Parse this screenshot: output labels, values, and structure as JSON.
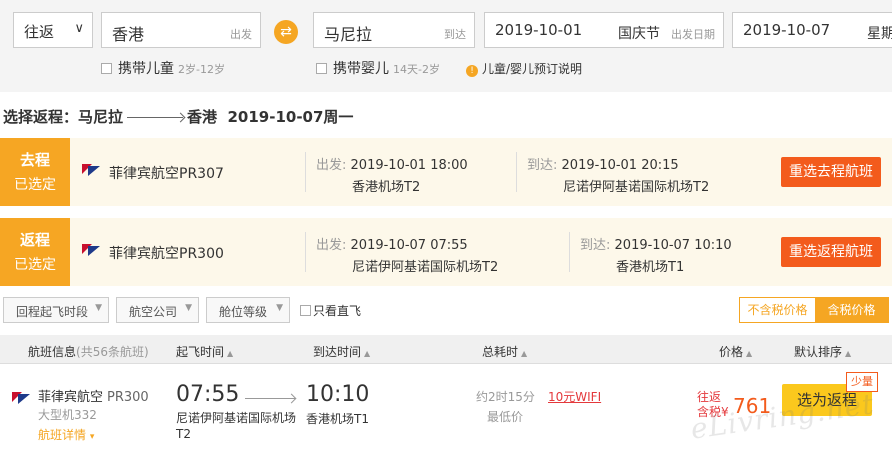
{
  "search": {
    "trip_type": "往返",
    "from_city": "香港",
    "from_hint": "出发",
    "swap_symbol": "⇄",
    "to_city": "马尼拉",
    "to_hint": "到达",
    "depart_date": "2019-10-01",
    "depart_holiday": "国庆节",
    "depart_hint": "出发日期",
    "return_date": "2019-10-07",
    "return_weekday": "星期",
    "child_label": "携带儿童",
    "child_age": "2岁-12岁",
    "infant_label": "携带婴儿",
    "infant_age": "14天-2岁",
    "note_label": "儿童/婴儿预订说明"
  },
  "route_title": {
    "prefix": "选择返程：马尼拉",
    "to": "香港",
    "date": "2019-10-07周一"
  },
  "selected": {
    "outbound": {
      "tag1": "去程",
      "tag2": "已选定",
      "airline": "菲律宾航空PR307",
      "dep_label": "出发:",
      "dep_time": "2019-10-01 18:00",
      "dep_airport": "香港机场T2",
      "arr_label": "到达:",
      "arr_time": "2019-10-01 20:15",
      "arr_airport": "尼诺伊阿基诺国际机场T2",
      "button": "重选去程航班"
    },
    "return": {
      "tag1": "返程",
      "tag2": "已选定",
      "airline": "菲律宾航空PR300",
      "dep_label": "出发:",
      "dep_time": "2019-10-07 07:55",
      "dep_airport": "尼诺伊阿基诺国际机场T2",
      "arr_label": "到达:",
      "arr_time": "2019-10-07 10:10",
      "arr_airport": "香港机场T1",
      "button": "重选返程航班"
    }
  },
  "filters": {
    "time": "回程起飞时段",
    "airline": "航空公司",
    "cabin": "舱位等级",
    "direct": "只看直飞",
    "price_excl": "不含税价格",
    "price_incl": "含税价格"
  },
  "list_header": {
    "info": "航班信息",
    "info_count": "(共56条航班)",
    "dep": "起飞时间",
    "arr": "到达时间",
    "duration": "总耗时",
    "price": "价格",
    "sort": "默认排序"
  },
  "flight": {
    "airline": "菲律宾航空",
    "flight_no": "PR300",
    "plane": "大型机332",
    "details": "航班详情",
    "dep_time": "07:55",
    "arr_time": "10:10",
    "dep_airport": "尼诺伊阿基诺国际机场T2",
    "arr_airport": "香港机场T1",
    "duration": "约2时15分",
    "lowest": "最低价",
    "wifi": "10元WIFI",
    "price_tag1": "往返",
    "price_tag2": "含税¥",
    "price": "761",
    "button": "选为返程",
    "scarce": "少量"
  },
  "watermark": "eLivring.net"
}
